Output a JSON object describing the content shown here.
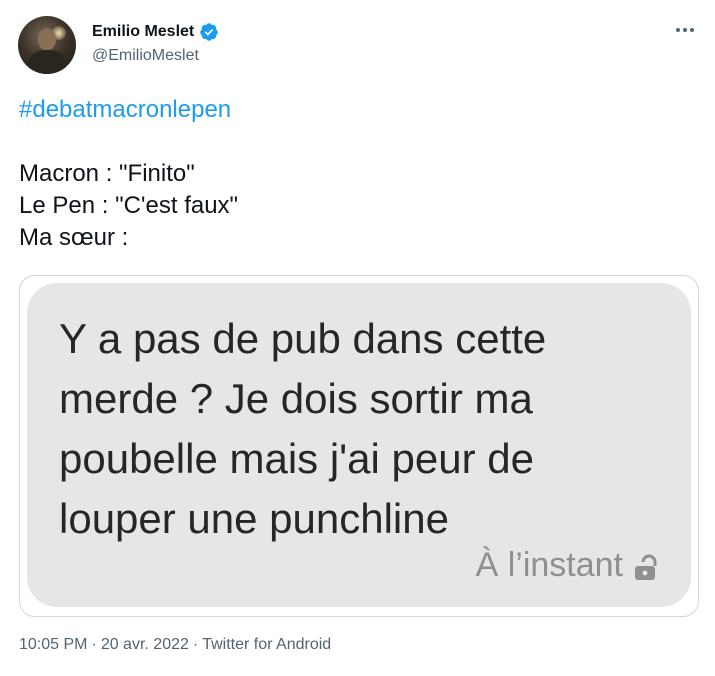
{
  "author": {
    "display_name": "Emilio Meslet",
    "handle": "@EmilioMeslet",
    "verified": true
  },
  "tweet": {
    "hashtag": "#debatmacronlepen",
    "lines": [
      "Macron : \"Finito\"",
      "Le Pen : \"C'est faux\"",
      "Ma sœur :"
    ]
  },
  "media": {
    "message_text": "Y a pas de pub dans cette merde ? Je dois sortir ma poubelle mais j'ai peur de louper une punchline",
    "message_time": "À l’instant",
    "bubble_color": "#e6e6e6"
  },
  "footer": {
    "time": "10:05 PM",
    "separator1": "·",
    "date": "20 avr. 2022",
    "separator2": "·",
    "source": "Twitter for Android"
  },
  "colors": {
    "accent": "#1d9bf0",
    "secondary_text": "#536471",
    "primary_text": "#0f1419"
  },
  "icons": {
    "more": "more-horizontal-icon",
    "verified": "verified-badge-icon",
    "lock": "unlocked-padlock-icon"
  }
}
